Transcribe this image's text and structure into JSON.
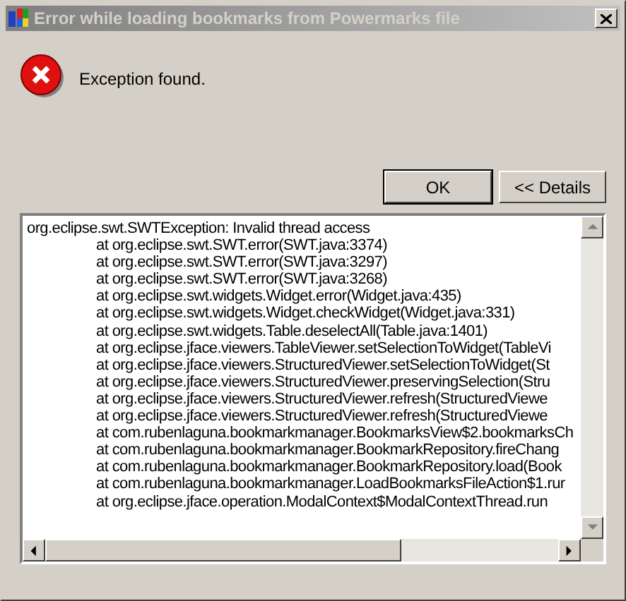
{
  "window": {
    "title": "Error while loading bookmarks from Powermarks file",
    "active": false
  },
  "message": "Exception found.",
  "buttons": [
    {
      "label": "OK",
      "default": true
    },
    {
      "label": "<< Details",
      "default": false
    }
  ],
  "details": {
    "exception": "org.eclipse.swt.SWTException: Invalid thread access",
    "frames": [
      "at org.eclipse.swt.SWT.error(SWT.java:3374)",
      "at org.eclipse.swt.SWT.error(SWT.java:3297)",
      "at org.eclipse.swt.SWT.error(SWT.java:3268)",
      "at org.eclipse.swt.widgets.Widget.error(Widget.java:435)",
      "at org.eclipse.swt.widgets.Widget.checkWidget(Widget.java:331)",
      "at org.eclipse.swt.widgets.Table.deselectAll(Table.java:1401)",
      "at org.eclipse.jface.viewers.TableViewer.setSelectionToWidget(TableVi",
      "at org.eclipse.jface.viewers.StructuredViewer.setSelectionToWidget(St",
      "at org.eclipse.jface.viewers.StructuredViewer.preservingSelection(Stru",
      "at org.eclipse.jface.viewers.StructuredViewer.refresh(StructuredViewe",
      "at org.eclipse.jface.viewers.StructuredViewer.refresh(StructuredViewe",
      "at com.rubenlaguna.bookmarkmanager.BookmarksView$2.bookmarksCh",
      "at com.rubenlaguna.bookmarkmanager.BookmarkRepository.fireChang",
      "at com.rubenlaguna.bookmarkmanager.BookmarkRepository.load(Book",
      "at com.rubenlaguna.bookmarkmanager.LoadBookmarksFileAction$1.rur",
      "at org.eclipse.jface.operation.ModalContext$ModalContextThread.run"
    ]
  }
}
